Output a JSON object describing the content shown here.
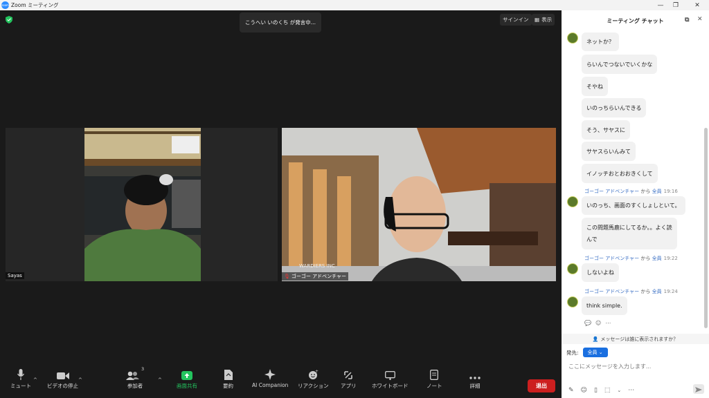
{
  "window": {
    "title": "Zoom ミーティング",
    "logo": "zoom"
  },
  "top": {
    "speaking": "こうへい いのくち が発言中...",
    "signin": "サインイン",
    "view": "表示"
  },
  "tiles": [
    {
      "name": "Sayas"
    },
    {
      "name": "ゴーゴー アドベンチャー",
      "watermark": "WARDIERS INC"
    }
  ],
  "toolbar": {
    "mute": "ミュート",
    "video": "ビデオの停止",
    "participants": "参加者",
    "participants_count": "3",
    "share": "画面共有",
    "summary": "要約",
    "ai": "AI Companion",
    "reactions": "リアクション",
    "apps": "アプリ",
    "whiteboard": "ホワイトボード",
    "notes": "ノート",
    "more": "詳細",
    "leave": "退出"
  },
  "chat": {
    "title": "ミーティング チャット",
    "messages": [
      {
        "text": "ネットか？"
      },
      {
        "text": "らいんでつないでいくかな"
      },
      {
        "text": "そやね"
      },
      {
        "text": "いのっちらいんできる"
      },
      {
        "text": "そう、サヤスに"
      },
      {
        "text": "サヤスらいんみて"
      },
      {
        "text": "イノッチおとおおきくして"
      }
    ],
    "groups": [
      {
        "sender": "ゴーゴー アドベンチャー",
        "from": "から",
        "to": "全員",
        "time": "19:16",
        "msgs": [
          "いのっち、画面のすくしょしといて。",
          "この問題馬鹿にしてるか。。よく読",
          "んで"
        ]
      },
      {
        "sender": "ゴーゴー アドベンチャー",
        "from": "から",
        "to": "全員",
        "time": "19:22",
        "msgs": [
          "しないよね"
        ]
      },
      {
        "sender": "ゴーゴー アドベンチャー",
        "from": "から",
        "to": "全員",
        "time": "19:24",
        "msgs": [
          "think simple."
        ]
      }
    ],
    "who_sees": "メッセージは誰に表示されますか？",
    "to_label": "発先:",
    "to_value": "全員",
    "placeholder": "ここにメッセージを入力します..."
  },
  "colors": {
    "accent": "#1a6fe0",
    "leave": "#cc1f1f",
    "share": "#23c45e"
  }
}
